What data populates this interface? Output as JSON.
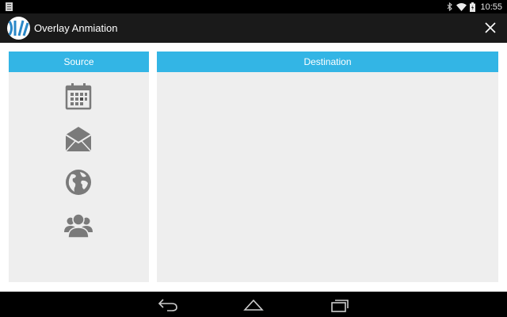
{
  "status_bar": {
    "time": "10:55",
    "icons": [
      "notification-icon",
      "bluetooth-icon",
      "wifi-icon",
      "battery-icon"
    ]
  },
  "action_bar": {
    "title": "Overlay Anmiation",
    "logo": "app-logo-icon",
    "close_icon": "close-icon"
  },
  "source_panel": {
    "title": "Source",
    "items": [
      {
        "icon": "calendar-icon"
      },
      {
        "icon": "mail-icon"
      },
      {
        "icon": "globe-icon"
      },
      {
        "icon": "users-icon"
      }
    ]
  },
  "destination_panel": {
    "title": "Destination"
  },
  "nav_bar": {
    "buttons": [
      "back-icon",
      "home-icon",
      "recents-icon"
    ]
  },
  "colors": {
    "accent": "#33b5e5",
    "panel_bg": "#eeeeee",
    "action_bar_bg": "#1a1a1a",
    "icon_gray": "#7a7a7a"
  }
}
